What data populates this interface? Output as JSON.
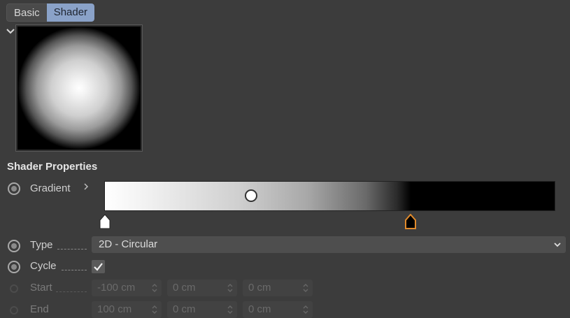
{
  "tabs": [
    {
      "label": "Basic",
      "active": false
    },
    {
      "label": "Shader",
      "active": true
    }
  ],
  "section_title": "Shader Properties",
  "gradient": {
    "label": "Gradient",
    "colors": [
      "#ffffff",
      "#000000"
    ],
    "knot_positions": [
      0.0,
      0.68
    ],
    "midpoint": 0.33
  },
  "type": {
    "label": "Type",
    "value": "2D - Circular"
  },
  "cycle": {
    "label": "Cycle",
    "checked": true
  },
  "start": {
    "label": "Start",
    "x": "-100 cm",
    "y": "0 cm",
    "z": "0 cm"
  },
  "end": {
    "label": "End",
    "x": "100 cm",
    "y": "0 cm",
    "z": "0 cm"
  },
  "colors": {
    "accent_tab": "#8aa2c8",
    "selected_knot": "#e08a2c"
  }
}
